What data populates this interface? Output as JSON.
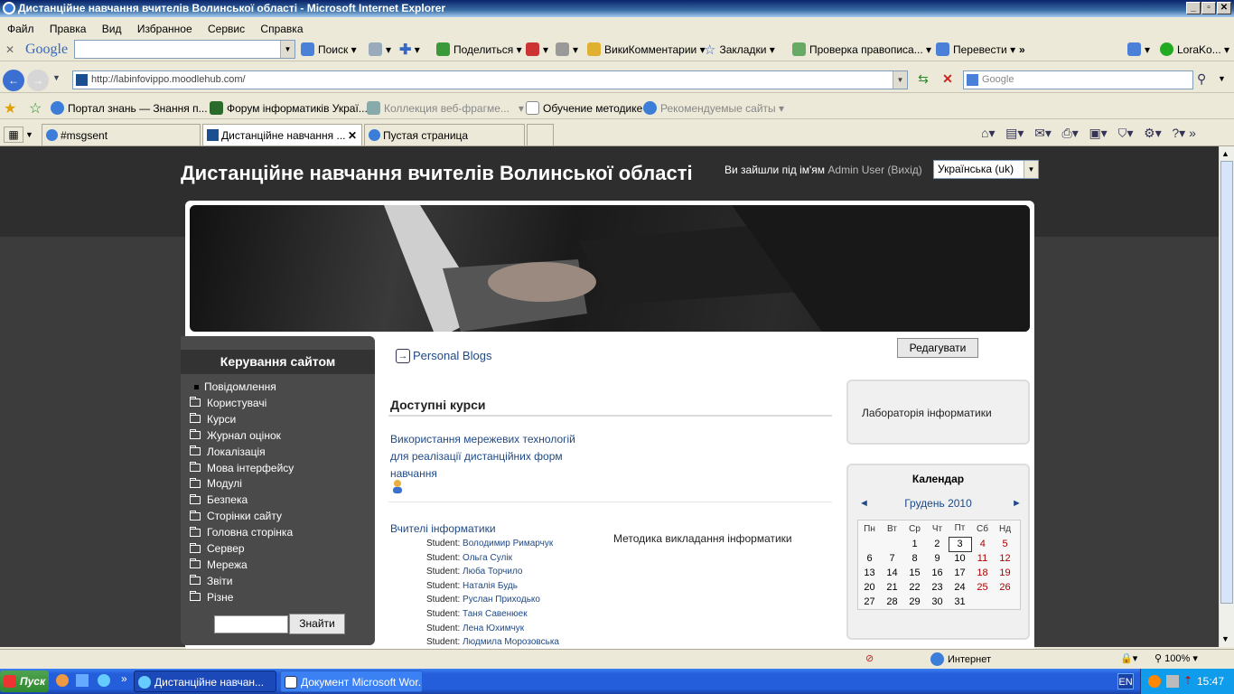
{
  "window": {
    "title": "Дистанційне навчання вчителів Волинської області - Microsoft Internet Explorer"
  },
  "menu": [
    "Файл",
    "Правка",
    "Вид",
    "Избранное",
    "Сервис",
    "Справка"
  ],
  "google_toolbar": {
    "logo": "Google",
    "search_label": "Поиск",
    "share": "Поделиться",
    "wiki": "ВикиКомментарии",
    "bookmarks": "Закладки",
    "spell": "Проверка правописа...",
    "translate": "Перевести",
    "user": "LoraKo..."
  },
  "address": {
    "url": "http://labinfovippo.moodlehub.com/",
    "search_placeholder": "Google"
  },
  "favorites": [
    "Портал знань — Знання п...",
    "Форум інформатиків Украї...",
    "Коллекция веб-фрагме...",
    "Обучение методике",
    "Рекомендуемые сайты"
  ],
  "tabs": [
    "#msgsent",
    "Дистанційне навчання ...",
    "Пустая страница"
  ],
  "site": {
    "title": "Дистанційне навчання вчителів Волинської області",
    "login_prefix": "Ви зайшли під ім'ям",
    "user": "Admin User",
    "logout": "(Вихід)",
    "language": "Українська (uk)",
    "edit_button": "Редагувати",
    "blogs_link": "Personal Blogs"
  },
  "sidebar": {
    "title": "Керування сайтом",
    "items": [
      "Повідомлення",
      "Користувачі",
      "Курси",
      "Журнал оцінок",
      "Локалізація",
      "Мова інтерфейсу",
      "Модулі",
      "Безпека",
      "Сторінки сайту",
      "Головна сторінка",
      "Сервер",
      "Мережа",
      "Звіти",
      "Різне"
    ],
    "search_button": "Знайти"
  },
  "courses": {
    "heading": "Доступні курси",
    "course1": {
      "line1": "Використання мережевих технологій",
      "line2": "для реалізації дистанційних форм",
      "line3": "навчання"
    },
    "course2": {
      "title": "Вчителі інформатики",
      "desc": "Методика викладання інформатики",
      "role": "Student:",
      "students": [
        "Володимир Римарчук",
        "Ольга Сулік",
        "Люба Торчило",
        "Наталія Будь",
        "Руслан Приходько",
        "Таня Савенюек",
        "Лена Юхимчук",
        "Людмила Морозовська"
      ]
    }
  },
  "rightblock": {
    "label": "Лабораторія інформатики"
  },
  "calendar": {
    "title": "Календар",
    "month": "Грудень 2010",
    "prev": "◄",
    "next": "►",
    "weekdays": [
      "Пн",
      "Вт",
      "Ср",
      "Чт",
      "Пт",
      "Сб",
      "Нд"
    ],
    "weeks": [
      [
        "",
        "",
        "1",
        "2",
        "3",
        "4",
        "5"
      ],
      [
        "6",
        "7",
        "8",
        "9",
        "10",
        "11",
        "12"
      ],
      [
        "13",
        "14",
        "15",
        "16",
        "17",
        "18",
        "19"
      ],
      [
        "20",
        "21",
        "22",
        "23",
        "24",
        "25",
        "26"
      ],
      [
        "27",
        "28",
        "29",
        "30",
        "31",
        "",
        ""
      ]
    ]
  },
  "status": {
    "zone": "Интернет",
    "zoom": "100%"
  },
  "taskbar": {
    "start": "Пуск",
    "items": [
      "Дистанційне навчан...",
      "Документ Microsoft Wor..."
    ],
    "lang": "EN",
    "time": "15:47"
  }
}
